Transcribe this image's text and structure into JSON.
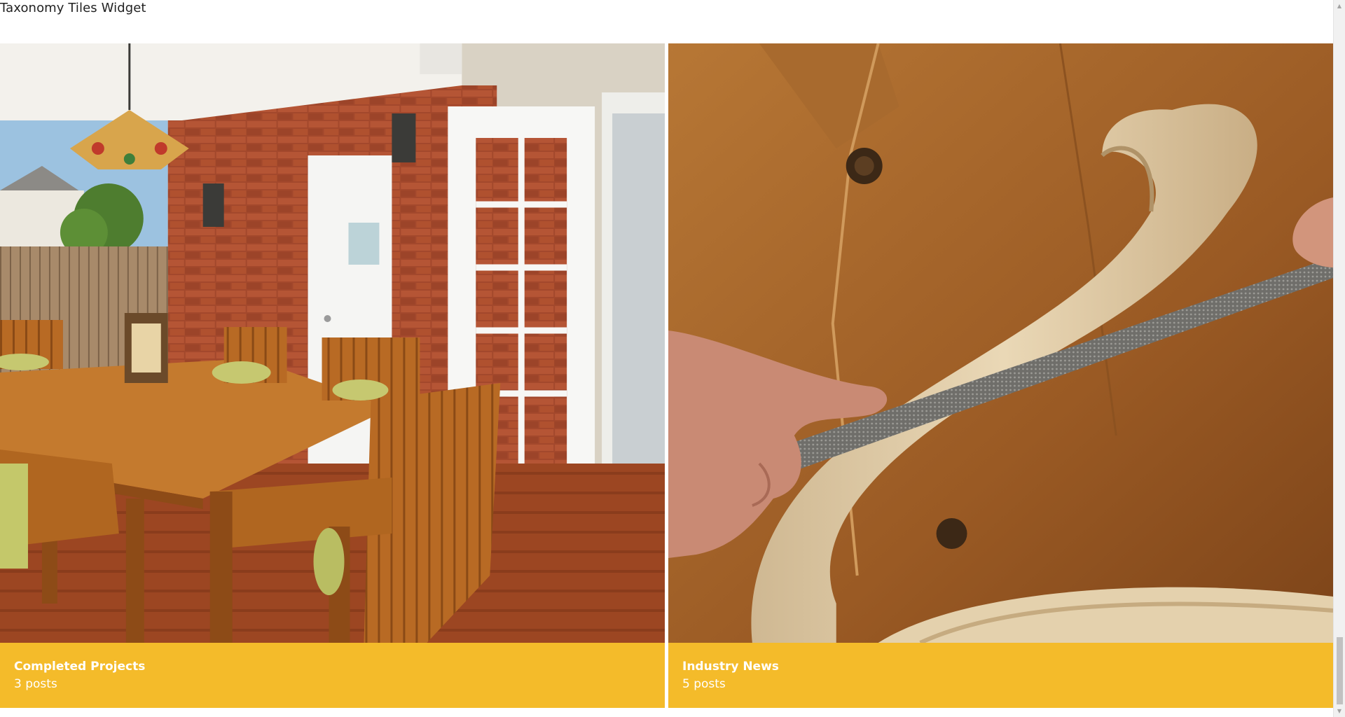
{
  "widget": {
    "title": "Taxonomy Tiles Widget"
  },
  "tiles": [
    {
      "name": "Completed Projects",
      "count": "3 posts",
      "image_subject": "patio-dining-set"
    },
    {
      "name": "Industry News",
      "count": "5 posts",
      "image_subject": "woodworking-file"
    }
  ],
  "colors": {
    "caption_bg": "#f4bb2a",
    "caption_text": "#ffffff"
  },
  "scrollbar": {
    "up_icon": "scroll-up-arrow-icon",
    "down_icon": "scroll-down-arrow-icon"
  }
}
